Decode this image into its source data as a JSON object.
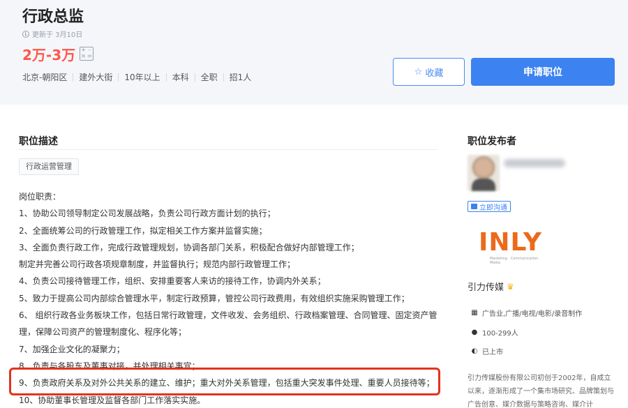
{
  "job": {
    "title": "行政总监",
    "updated": "更新于 3月10日",
    "salary": "2万-3万",
    "calc_icon_glyphs": [
      "+",
      "-",
      "×",
      "="
    ],
    "tags": [
      "北京-朝阳区",
      "建外大街",
      "10年以上",
      "本科",
      "全职",
      "招1人"
    ]
  },
  "actions": {
    "favorite_label": "收藏",
    "apply_label": "申请职位"
  },
  "description": {
    "heading": "职位描述",
    "category_tag": "行政运营管理",
    "lines": [
      "岗位职责：",
      "1、协助公司领导制定公司发展战略，负责公司行政方面计划的执行；",
      "2、全面统筹公司的行政管理工作，拟定相关工作方案并监督实施；",
      "3、全面负责行政工作，完成行政管理规划，协调各部门关系，积极配合做好内部管理工作；",
      "制定并完善公司行政各项规章制度，并监督执行；规范内部行政管理工作；",
      "4、负责公司接待管理工作，组织、安排重要客人来访的接待工作，协调内外关系；",
      "5、致力于提高公司内部综合管理水平，制定行政预算，管控公司行政费用，有效组织实施采购管理工作；",
      "6、  组织行政各业务板块工作，包括日常行政管理，文件收发、会务组织、行政档案管理、合同管理、固定资产管",
      "理，保障公司资产的管理制度化、程序化等；",
      "7、加强企业文化的凝聚力；",
      "8、负责与各股东及董事对接，并处理相关事宜；",
      "9、负责政府关系及对外公共关系的建立、维护；重大对外关系管理，包括重大突发事件处理、重要人员接待等；",
      "10、协助董事长管理及监督各部门工作落实实施。"
    ]
  },
  "publisher": {
    "heading": "职位发布者",
    "chat_label": "立即沟通"
  },
  "company": {
    "logo_text": "INLY",
    "logo_tagline": "Marketing · Communication · Media",
    "name": "引力传媒",
    "industry": "广告业,广播/电视/电影/录音制作",
    "size": "100-299人",
    "stage": "已上市",
    "description": "引力传媒股份有限公司初创于2002年，自成立以来，逐渐形成了一个集市场研究、品牌策划与广告创意、媒介数据与策略咨询、媒介计"
  },
  "colors": {
    "salary": "#fe574a",
    "primary": "#3c82f0",
    "highlight_border": "#e3321e",
    "logo": "#ec6a1c"
  }
}
